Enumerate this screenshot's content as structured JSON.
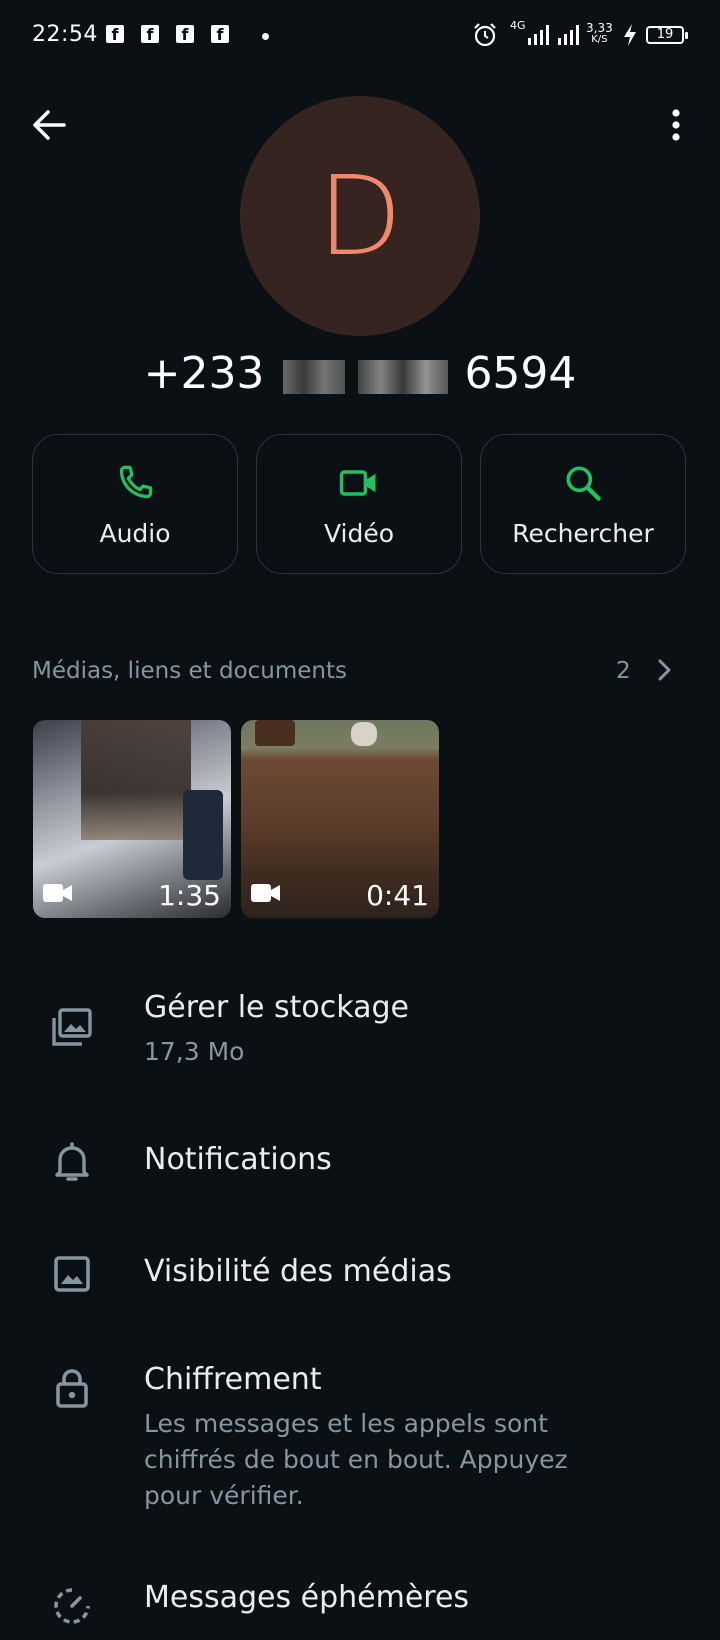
{
  "status_bar": {
    "time": "22:54",
    "battery": "19",
    "network_label": "4G",
    "speed_value": "3,33",
    "speed_unit": "K/S"
  },
  "contact": {
    "avatar_letter": "D",
    "phone_visible_prefix": "+233",
    "phone_visible_suffix": "6594"
  },
  "actions": [
    {
      "label": "Audio",
      "icon": "phone-icon"
    },
    {
      "label": "Vidéo",
      "icon": "video-icon"
    },
    {
      "label": "Rechercher",
      "icon": "search-icon"
    }
  ],
  "media": {
    "title": "Médias, liens et documents",
    "count": "2",
    "items": [
      {
        "duration": "1:35",
        "type": "video"
      },
      {
        "duration": "0:41",
        "type": "video"
      }
    ]
  },
  "settings": {
    "storage": {
      "title": "Gérer le stockage",
      "subtitle": "17,3 Mo"
    },
    "notifications": {
      "title": "Notifications"
    },
    "media_visibility": {
      "title": "Visibilité des médias"
    },
    "encryption": {
      "title": "Chiffrement",
      "subtitle": "Les messages et les appels sont chiffrés de bout en bout. Appuyez pour vérifier."
    },
    "disappearing": {
      "title": "Messages éphémères"
    }
  },
  "colors": {
    "background": "#0b1014",
    "accent_green": "#21c063",
    "avatar_bg": "#35241f",
    "avatar_fg": "#f2886b",
    "secondary_text": "#8696a0"
  }
}
